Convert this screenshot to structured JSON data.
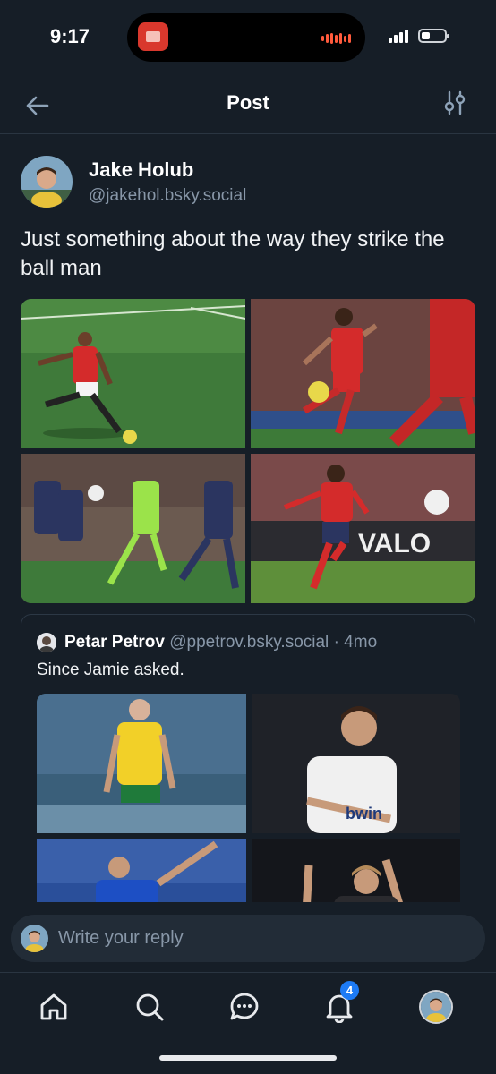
{
  "status_bar": {
    "time": "9:17"
  },
  "header": {
    "title": "Post"
  },
  "post": {
    "author_name": "Jake Holub",
    "author_handle": "@jakehol.bsky.social",
    "text": "Just something about the way they strike the ball man",
    "images": [
      "footballer-red-kit-striking-ball",
      "footballer-red-kit-volley",
      "youth-players-green-and-navy-kits",
      "footballer-red-kit-free-kick"
    ]
  },
  "quote": {
    "author_name": "Petar Petrov",
    "author_handle": "@ppetrov.bsky.social",
    "age": "· 4mo",
    "text": "Since Jamie asked.",
    "images": [
      "player-yellow-green-kit",
      "player-white-kit",
      "player-blue-kit-celebrating",
      "player-dark-kit-celebrating"
    ]
  },
  "reply": {
    "placeholder": "Write your reply"
  },
  "nav": {
    "items": [
      "home",
      "search",
      "chat",
      "notifications",
      "profile"
    ],
    "notifications_badge": "4"
  },
  "colors": {
    "background": "#161e27",
    "accent": "#1d7bf5",
    "muted_text": "#8897a8"
  }
}
